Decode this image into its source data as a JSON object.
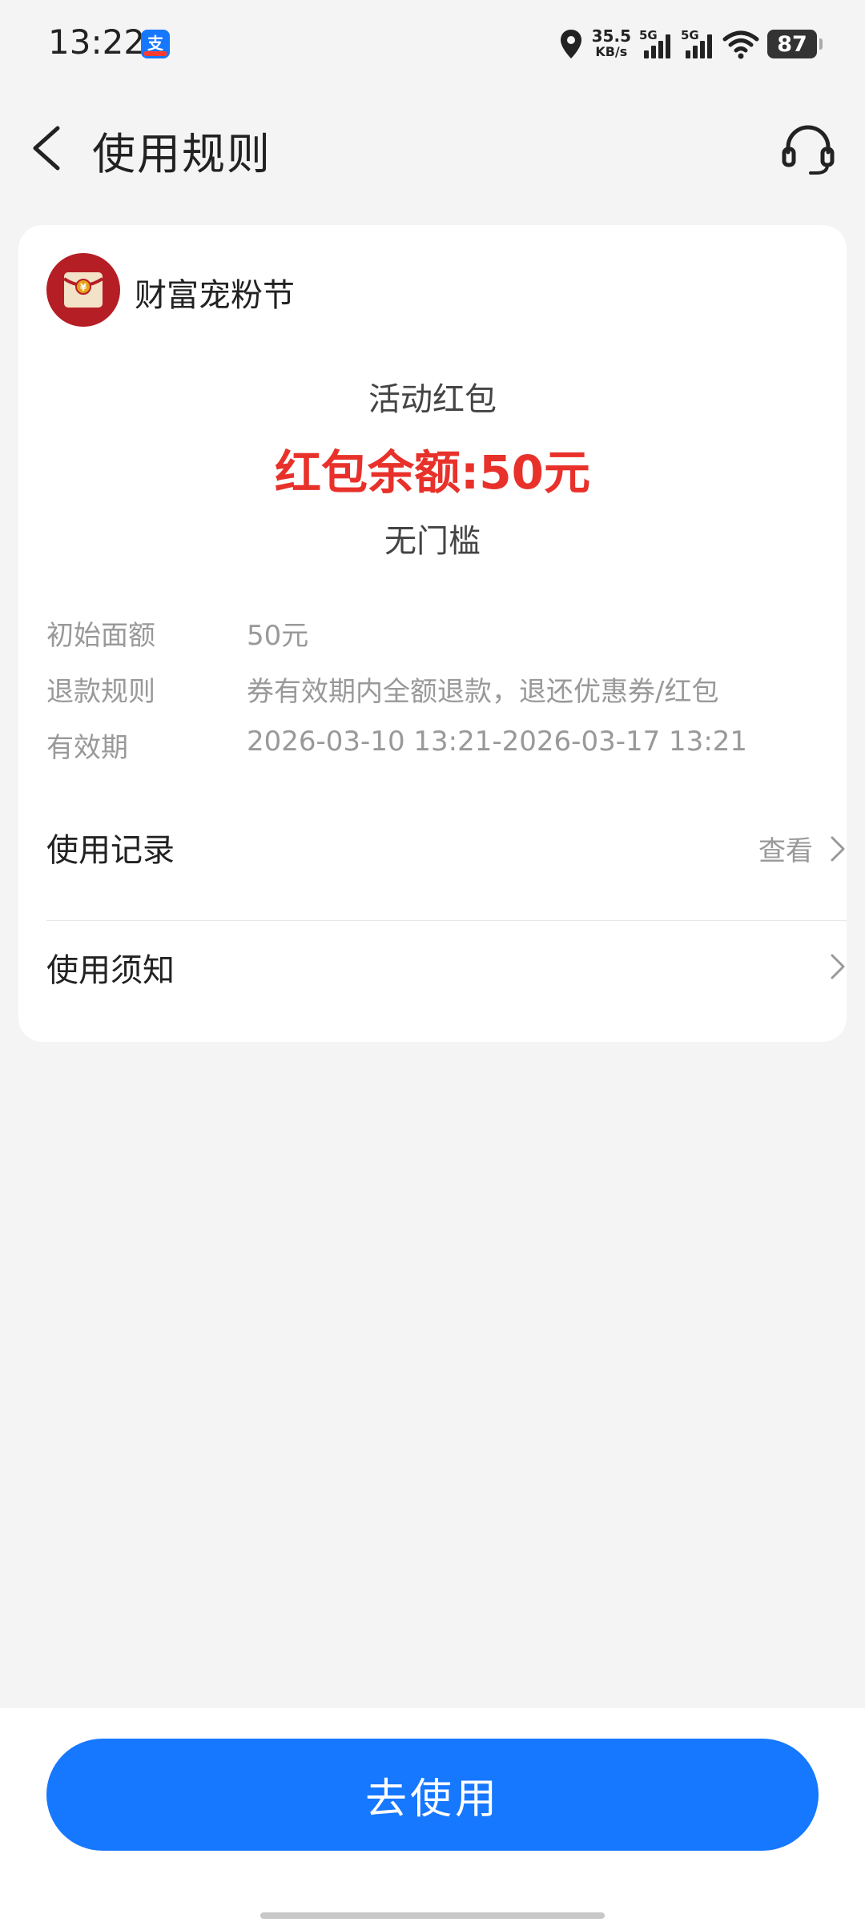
{
  "status_bar": {
    "time": "13:22",
    "net_speed_value": "35.5",
    "net_speed_unit": "KB/s",
    "signal_1_tag": "5G",
    "signal_2_tag": "5G",
    "battery": "87",
    "icons": [
      "alipay-app-icon",
      "location-icon",
      "signal-icon",
      "signal-icon",
      "wifi-icon",
      "battery-icon"
    ]
  },
  "nav": {
    "title": "使用规则",
    "back_icon": "chevron-left-icon",
    "service_icon": "headset-icon"
  },
  "card": {
    "merchant_name": "财富宠粉节",
    "merchant_logo_icon": "red-envelope-icon",
    "coupon_type": "活动红包",
    "balance": "红包余额:50元",
    "threshold": "无门槛",
    "details": [
      {
        "label": "初始面额",
        "value": "50元"
      },
      {
        "label": "退款规则",
        "value": "券有效期内全额退款，退还优惠券/红包"
      },
      {
        "label": "有效期",
        "value": "2026-03-10 13:21-2026-03-17 13:21"
      }
    ],
    "usage_record": {
      "title": "使用记录",
      "action": "查看"
    },
    "usage_notice": {
      "title": "使用须知"
    }
  },
  "bottom": {
    "button_label": "去使用"
  },
  "colors": {
    "accent_blue": "#1677ff",
    "balance_red": "#e8312a",
    "logo_red": "#b51e24",
    "background": "#f4f4f4"
  }
}
